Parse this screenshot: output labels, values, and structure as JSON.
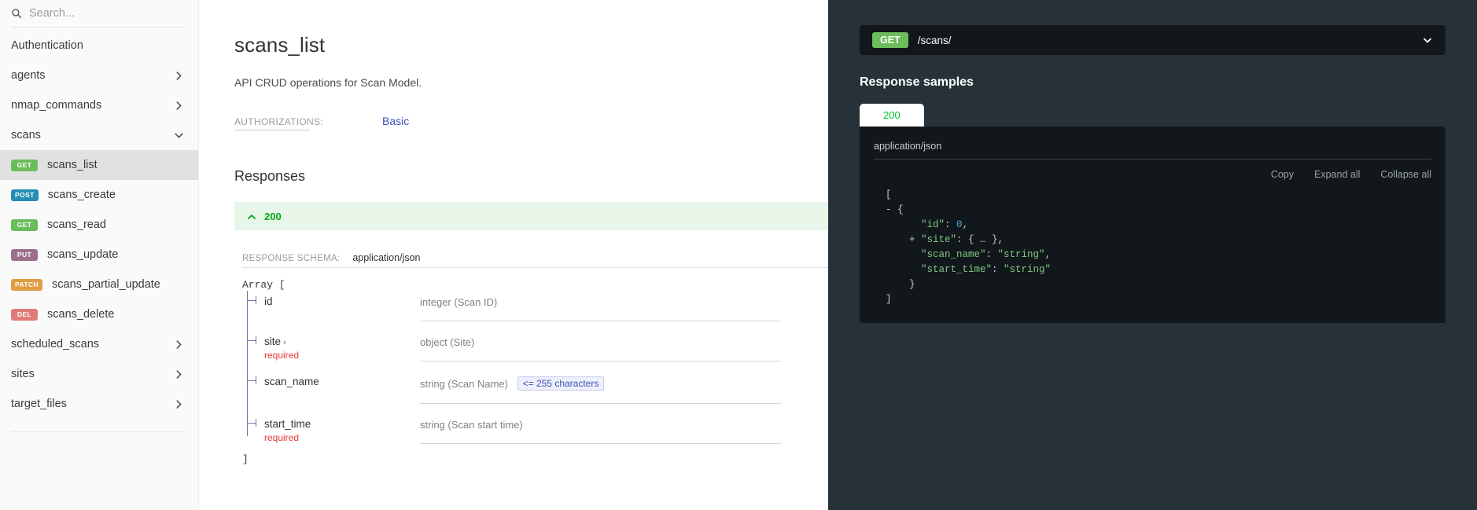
{
  "sidebar": {
    "search": {
      "placeholder": "Search...",
      "value": "",
      "icon": "search-icon"
    },
    "items": [
      {
        "label": "Authentication",
        "type": "section",
        "expandable": false
      },
      {
        "label": "agents",
        "type": "group",
        "expandable": true,
        "expanded": false,
        "icon": "chevron-right-icon"
      },
      {
        "label": "nmap_commands",
        "type": "group",
        "expandable": true,
        "expanded": false,
        "icon": "chevron-right-icon"
      },
      {
        "label": "scans",
        "type": "group",
        "expandable": true,
        "expanded": true,
        "icon": "chevron-down-icon"
      }
    ],
    "operations": [
      {
        "verb": "GET",
        "verb_class": "get",
        "label": "scans_list",
        "active": true
      },
      {
        "verb": "POST",
        "verb_class": "post",
        "label": "scans_create",
        "active": false
      },
      {
        "verb": "GET",
        "verb_class": "get",
        "label": "scans_read",
        "active": false
      },
      {
        "verb": "PUT",
        "verb_class": "put",
        "label": "scans_update",
        "active": false
      },
      {
        "verb": "PATCH",
        "verb_class": "patch",
        "label": "scans_partial_update",
        "active": false
      },
      {
        "verb": "DEL",
        "verb_class": "del",
        "label": "scans_delete",
        "active": false
      }
    ],
    "trailing_groups": [
      {
        "label": "scheduled_scans",
        "icon": "chevron-right-icon"
      },
      {
        "label": "sites",
        "icon": "chevron-right-icon"
      },
      {
        "label": "target_files",
        "icon": "chevron-right-icon"
      }
    ],
    "colors": {
      "get": "#6bbd5b",
      "post": "#248fb2",
      "put": "#9b708b",
      "patch": "#e09d43",
      "del": "#e27a7a",
      "active_row": "#e1e1e1"
    }
  },
  "main": {
    "title": "scans_list",
    "description": "API CRUD operations for Scan Model.",
    "authorizations_label": "AUTHORIZATIONS:",
    "authorizations_value": "Basic",
    "responses_heading": "Responses",
    "response": {
      "code": "200",
      "expanded": true,
      "toggle_icon": "chevron-up-icon",
      "accent_color": "#00aa13",
      "background": "#e8f5e9"
    },
    "schema": {
      "label": "RESPONSE SCHEMA:",
      "media_type": "application/json",
      "open_token": "Array [",
      "close_token": "]",
      "properties": [
        {
          "name": "id",
          "expandable": false,
          "required": "",
          "type": "integer (Scan ID)",
          "constraint": ""
        },
        {
          "name": "site",
          "expandable": true,
          "expand_icon": "chevron-right-icon",
          "required": "required",
          "type": "object (Site)",
          "constraint": ""
        },
        {
          "name": "scan_name",
          "expandable": false,
          "required": "",
          "type": "string (Scan Name)",
          "constraint": "<= 255 characters"
        },
        {
          "name": "start_time",
          "expandable": false,
          "required": "required",
          "type": "string (Scan start time)",
          "constraint": ""
        }
      ]
    }
  },
  "right_panel": {
    "endpoint": {
      "verb": "GET",
      "path": "/scans/",
      "toggle_icon": "chevron-down-icon",
      "verb_color": "#6bbd5b",
      "bar_background": "#11171a"
    },
    "samples_heading": "Response samples",
    "tabs": [
      {
        "label": "200",
        "active": true,
        "color": "#00c92c"
      }
    ],
    "media_type": "application/json",
    "actions": [
      {
        "label": "Copy",
        "name": "copy-button"
      },
      {
        "label": "Expand all",
        "name": "expand-all-button"
      },
      {
        "label": "Collapse all",
        "name": "collapse-all-button"
      }
    ],
    "code_lines": [
      {
        "indent": 0,
        "toggle": "",
        "parts": [
          {
            "t": "[",
            "c": "jp"
          }
        ]
      },
      {
        "indent": 1,
        "toggle": "-",
        "parts": [
          {
            "t": "{",
            "c": "jp"
          }
        ]
      },
      {
        "indent": 3,
        "toggle": "",
        "parts": [
          {
            "t": "\"id\"",
            "c": "jk"
          },
          {
            "t": ": ",
            "c": "jp"
          },
          {
            "t": "0",
            "c": "jnum"
          },
          {
            "t": ",",
            "c": "jp"
          }
        ]
      },
      {
        "indent": 3,
        "toggle": "+",
        "parts": [
          {
            "t": "\"site\"",
            "c": "jk"
          },
          {
            "t": ": { … },",
            "c": "jp"
          }
        ]
      },
      {
        "indent": 3,
        "toggle": "",
        "parts": [
          {
            "t": "\"scan_name\"",
            "c": "jk"
          },
          {
            "t": ": ",
            "c": "jp"
          },
          {
            "t": "\"string\"",
            "c": "jstr"
          },
          {
            "t": ",",
            "c": "jp"
          }
        ]
      },
      {
        "indent": 3,
        "toggle": "",
        "parts": [
          {
            "t": "\"start_time\"",
            "c": "jk"
          },
          {
            "t": ": ",
            "c": "jp"
          },
          {
            "t": "\"string\"",
            "c": "jstr"
          }
        ]
      },
      {
        "indent": 2,
        "toggle": "",
        "parts": [
          {
            "t": "}",
            "c": "jp"
          }
        ]
      },
      {
        "indent": 0,
        "toggle": "",
        "parts": [
          {
            "t": "]",
            "c": "jp"
          }
        ]
      }
    ],
    "background": "#263238"
  }
}
